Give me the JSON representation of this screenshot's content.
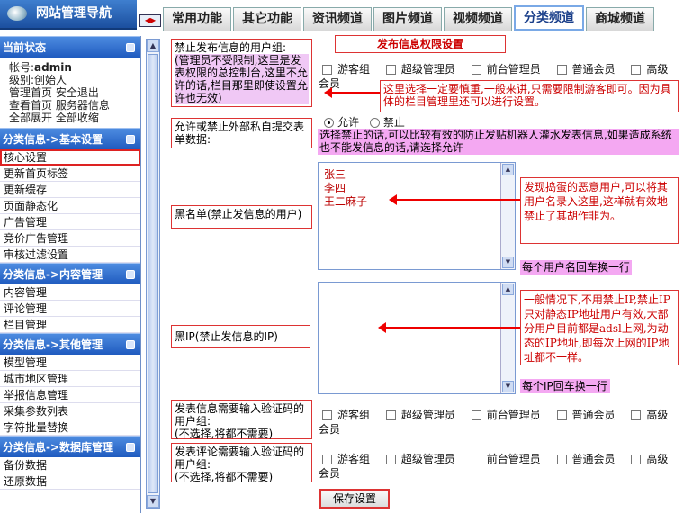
{
  "header": {
    "title": "网站管理导航"
  },
  "tabs": [
    "常用功能",
    "其它功能",
    "资讯频道",
    "图片频道",
    "视频频道",
    "分类频道",
    "商城频道"
  ],
  "active_tab_index": 5,
  "sidebar": {
    "status_title": "当前状态",
    "account_label": "帐号:",
    "account_value": "admin",
    "level_label": "级别:",
    "level_value": "创始人",
    "links_line1": "管理首页  安全退出",
    "links_line2": "查看首页  服务器信息",
    "links_line3": "全部展开  全部收缩",
    "sections": [
      {
        "title": "分类信息->基本设置",
        "items": [
          "核心设置",
          "更新首页标签",
          "更新缓存",
          "页面静态化",
          "广告管理",
          "竞价广告管理",
          "审核过滤设置"
        ]
      },
      {
        "title": "分类信息->内容管理",
        "items": [
          "内容管理",
          "评论管理",
          "栏目管理"
        ]
      },
      {
        "title": "分类信息->其他管理",
        "items": [
          "模型管理",
          "城市地区管理",
          "举报信息管理",
          "采集参数列表",
          "字符批量替换"
        ]
      },
      {
        "title": "分类信息->数据库管理",
        "items": [
          "备份数据",
          "还原数据"
        ]
      }
    ]
  },
  "main": {
    "page_title": "发布信息权限设置",
    "groups": [
      "游客组",
      "超级管理员",
      "前台管理员",
      "普通会员",
      "高级会员"
    ],
    "row1_label": "禁止发布信息的用户组:",
    "row1_note": "(管理员不受限制,这里是发表权限的总控制台,这里不允许的话,栏目那里即使设置允许也无效)",
    "row1_callout": "这里选择一定要慎重,一般来讲,只需要限制游客即可。因为具体的栏目管理里还可以进行设置。",
    "row2_label": "允许或禁止外部私自提交表单数据:",
    "row2_allow": "允许",
    "row2_deny": "禁止",
    "row2_note": "选择禁止的话,可以比较有效的防止发贴机器人灌水发表信息,如果造成系统也不能发信息的话,请选择允许",
    "row3_label": "黑名单(禁止发信息的用户)",
    "row3_users": [
      "张三",
      "李四",
      "王二麻子"
    ],
    "row3_callout": "发现捣蛋的恶意用户,可以将其用户名录入这里,这样就有效地禁止了其胡作非为。",
    "row3_hint": "每个用户名回车换一行",
    "row4_label": "黑IP(禁止发信息的IP)",
    "row4_callout": "一般情况下,不用禁止IP,禁止IP只对静态IP地址用户有效,大部分用户目前都是adsl上网,为动态的IP地址,即每次上网的IP地址都不一样。",
    "row4_hint": "每个IP回车换一行",
    "row5_label": "发表信息需要输入验证码的用户组:",
    "row5_note": "(不选择,将都不需要)",
    "row6_label": "发表评论需要输入验证码的用户组:",
    "row6_note": "(不选择,将都不需要)",
    "save_label": "保存设置"
  }
}
